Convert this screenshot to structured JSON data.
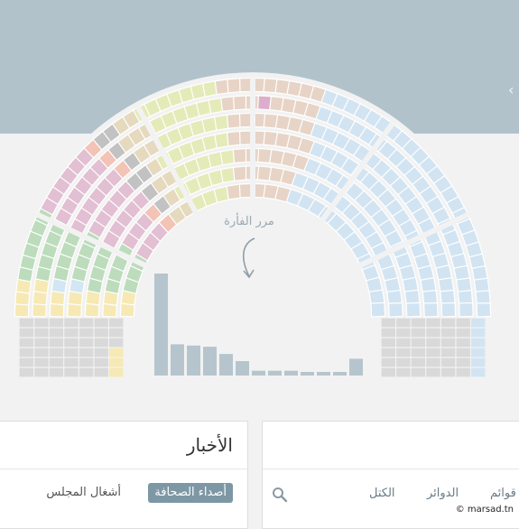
{
  "header": {
    "chevron_icon": "chevron-left-icon"
  },
  "colors": {
    "header_band": "#b1c2cb",
    "seat_empty": "#d9d9d9",
    "histogram_bar": "#b6c5cd",
    "tab_active": "#7d97a5"
  },
  "hemicycle": {
    "hint_text": "مرر الفأرة",
    "hint_icon": "curved-arrow-down-icon",
    "groups": [
      {
        "color": "#f6e9b3",
        "seats": 16
      },
      {
        "color": "#d2e7f3",
        "seats": 2
      },
      {
        "color": "#bcdcbc",
        "seats": 30
      },
      {
        "color": "#e2bfd2",
        "seats": 34
      },
      {
        "color": "#f3c3b6",
        "seats": 5
      },
      {
        "color": "#c2c2c2",
        "seats": 8
      },
      {
        "color": "#e5d9be",
        "seats": 13
      },
      {
        "color": "#e4ebb8",
        "seats": 38
      },
      {
        "color": "#e7d4c6",
        "seats": 20
      },
      {
        "color": "#dcaecb",
        "seats": 1
      },
      {
        "color": "#e7d4c6",
        "seats": 26
      },
      {
        "color": "#d2e4f2",
        "seats": 128
      }
    ],
    "histogram": [
      8.5,
      2.6,
      2.5,
      2.4,
      1.8,
      1.2,
      0.4,
      0.4,
      0.4,
      0.3,
      0.3,
      0.3,
      1.4
    ]
  },
  "news_panel": {
    "title": "الأخبار",
    "tab_active": "أصداء الصحافة",
    "tab_inactive": "أشغال المجلس"
  },
  "search_panel": {
    "search_icon": "search-icon",
    "filters": [
      "الكتل",
      "الدوائر",
      "قوائم"
    ]
  },
  "credit": "© marsad.tn"
}
